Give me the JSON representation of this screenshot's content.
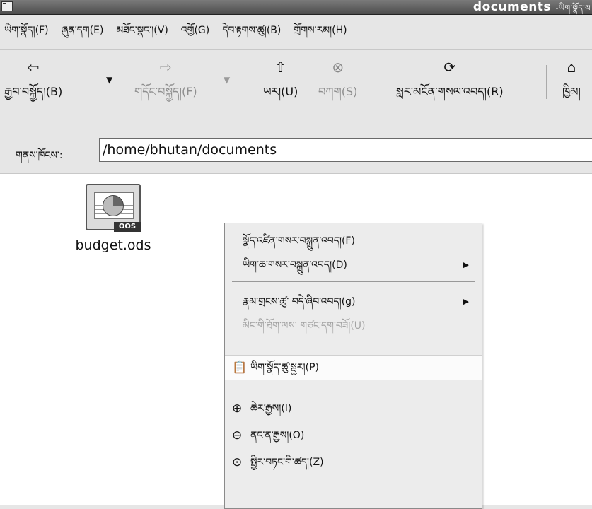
{
  "window": {
    "title": "documents",
    "title_suffix": "-ཡིག་སྣོད་ས"
  },
  "menubar": {
    "items": [
      {
        "label": "ཡིག་སྣོད།(F)"
      },
      {
        "label": "ཞུན་དག(E)"
      },
      {
        "label": "མཐོང་སྣང་།(V)"
      },
      {
        "label": "འགྱོ(G)"
      },
      {
        "label": "དེབ་རྟགས་ཚུ།(B)"
      },
      {
        "label": "གྲོགས་རམ།(H)"
      }
    ]
  },
  "toolbar": {
    "back_label": "རྒྱབ་བསྐྱོད།(B)",
    "forward_label": "གདོང་བསྐྱོད།(F)",
    "up_label": "ཡར།(U)",
    "stop_label": "བཀག(S)",
    "reload_label": "སླར་མངོན་གསལ་འབད།(R)",
    "home_label": "ཁྱིམ།"
  },
  "location": {
    "label": "གནས་ཁོངས་:",
    "value": "/home/bhutan/documents"
  },
  "files": [
    {
      "name": "budget.ods",
      "badge": "OOS"
    }
  ],
  "context_menu": {
    "items": [
      {
        "label": "སྣོད་འཛིན་གསར་བསྐྲུན་འབད།(F)"
      },
      {
        "label": "ཡིག་ཆ་གསར་བསྐྲུན་འབད།(D)"
      },
      {
        "label": "རྣམ་གྲངས་ཚུ་ བདེ་ཞིབ་འབད།(g)"
      },
      {
        "label": "མིང་གི་ཐོག་ལས་ གཙང་དག་བཟོ།(U)"
      },
      {
        "label": "ཡིག་སྣོད་ཚུ་སྦྱར།(P)"
      },
      {
        "label": "ཆེར་རྒྱས།(I)"
      },
      {
        "label": "ནང་ན་རྒྱས།(O)"
      },
      {
        "label": "སྤྱིར་བཏང་གི་ཚད།(Z)"
      }
    ]
  }
}
